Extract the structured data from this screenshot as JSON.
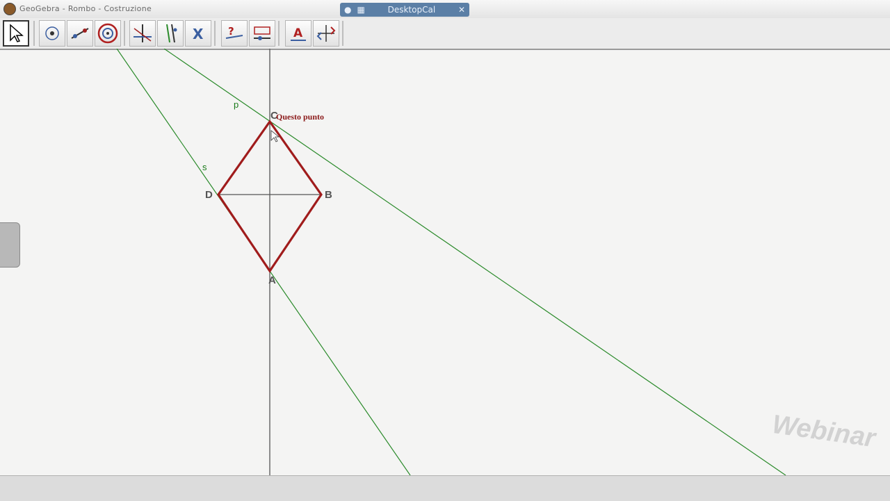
{
  "window": {
    "title": "GeoGebra - Rombo - Costruzione",
    "remote_session_label": "DesktopCal"
  },
  "toolbar": {
    "tools": [
      {
        "name": "move-tool",
        "icon": "arrow-pointer-icon",
        "active": true
      },
      {
        "name": "point-tool",
        "icon": "point-icon"
      },
      {
        "name": "line-tool",
        "icon": "line-icon"
      },
      {
        "name": "circle-tool",
        "icon": "circle-icon"
      },
      {
        "name": "perpendicular-tool",
        "icon": "perpendicular-icon"
      },
      {
        "name": "parallel-tool",
        "icon": "parallel-icon"
      },
      {
        "name": "intersect-tool",
        "icon": "intersect-icon"
      },
      {
        "name": "relation-tool",
        "icon": "relation-icon"
      },
      {
        "name": "slider-tool",
        "icon": "slider-icon"
      },
      {
        "name": "text-tool",
        "icon": "text-icon"
      },
      {
        "name": "view-tool",
        "icon": "move-view-icon"
      }
    ]
  },
  "construction": {
    "points": [
      {
        "id": "A",
        "label": "A"
      },
      {
        "id": "B",
        "label": "B"
      },
      {
        "id": "C",
        "label": "C"
      },
      {
        "id": "D",
        "label": "D"
      }
    ],
    "lines": [
      {
        "id": "p",
        "label": "p"
      },
      {
        "id": "s",
        "label": "s"
      }
    ],
    "annotation": "Questo punto",
    "colors": {
      "rhombus": "#a01c1c",
      "lines": "#2a8a2a",
      "axis": "#555555",
      "annotation": "#8b1a1a"
    }
  },
  "watermark": "Webinar"
}
